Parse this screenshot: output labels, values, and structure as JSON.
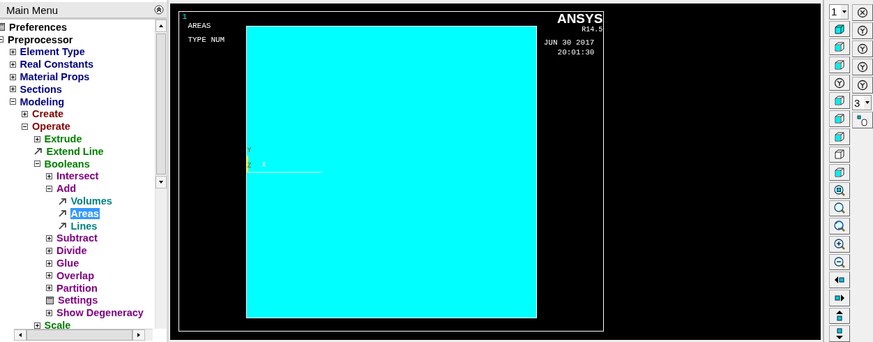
{
  "main_menu": {
    "title": "Main Menu",
    "tree": [
      {
        "label": "Preferences",
        "kind": "dialog",
        "selected": false
      },
      {
        "label": "Preprocessor",
        "kind": "folder",
        "expanded": true,
        "selected": false,
        "children": [
          {
            "label": "Element Type",
            "kind": "folder",
            "expanded": false,
            "selected": false
          },
          {
            "label": "Real Constants",
            "kind": "folder",
            "expanded": false,
            "selected": false
          },
          {
            "label": "Material Props",
            "kind": "folder",
            "expanded": false,
            "selected": false
          },
          {
            "label": "Sections",
            "kind": "folder",
            "expanded": false,
            "selected": false
          },
          {
            "label": "Modeling",
            "kind": "folder",
            "expanded": true,
            "selected": false,
            "children": [
              {
                "label": "Create",
                "kind": "folder",
                "expanded": false,
                "selected": false
              },
              {
                "label": "Operate",
                "kind": "folder",
                "expanded": true,
                "selected": false,
                "children": [
                  {
                    "label": "Extrude",
                    "kind": "folder",
                    "expanded": false,
                    "selected": false
                  },
                  {
                    "label": "Extend Line",
                    "kind": "action",
                    "selected": false
                  },
                  {
                    "label": "Booleans",
                    "kind": "folder",
                    "expanded": true,
                    "selected": false,
                    "children": [
                      {
                        "label": "Intersect",
                        "kind": "folder",
                        "expanded": false,
                        "selected": false
                      },
                      {
                        "label": "Add",
                        "kind": "folder",
                        "expanded": true,
                        "selected": false,
                        "children": [
                          {
                            "label": "Volumes",
                            "kind": "action",
                            "selected": false
                          },
                          {
                            "label": "Areas",
                            "kind": "action",
                            "selected": true
                          },
                          {
                            "label": "Lines",
                            "kind": "action",
                            "selected": false
                          }
                        ]
                      },
                      {
                        "label": "Subtract",
                        "kind": "folder",
                        "expanded": false,
                        "selected": false
                      },
                      {
                        "label": "Divide",
                        "kind": "folder",
                        "expanded": false,
                        "selected": false
                      },
                      {
                        "label": "Glue",
                        "kind": "folder",
                        "expanded": false,
                        "selected": false
                      },
                      {
                        "label": "Overlap",
                        "kind": "folder",
                        "expanded": false,
                        "selected": false
                      },
                      {
                        "label": "Partition",
                        "kind": "folder",
                        "expanded": false,
                        "selected": false
                      },
                      {
                        "label": "Settings",
                        "kind": "dialog",
                        "selected": false
                      },
                      {
                        "label": "Show Degeneracy",
                        "kind": "folder",
                        "expanded": false,
                        "selected": false
                      }
                    ]
                  },
                  {
                    "label": "Scale",
                    "kind": "folder",
                    "expanded": false,
                    "selected": false
                  }
                ]
              }
            ]
          }
        ]
      }
    ]
  },
  "graphics": {
    "window_number": "1",
    "plot_labels": [
      "AREAS",
      "TYPE NUM"
    ],
    "logo": "ANSYS",
    "version": "R14.5",
    "date": "JUN 30 2017",
    "time": "20:01:30",
    "axes": {
      "y": "Y",
      "z": "Z",
      "x": "X"
    }
  },
  "toolbar": {
    "window_select": "1",
    "rotation_step": "3"
  }
}
